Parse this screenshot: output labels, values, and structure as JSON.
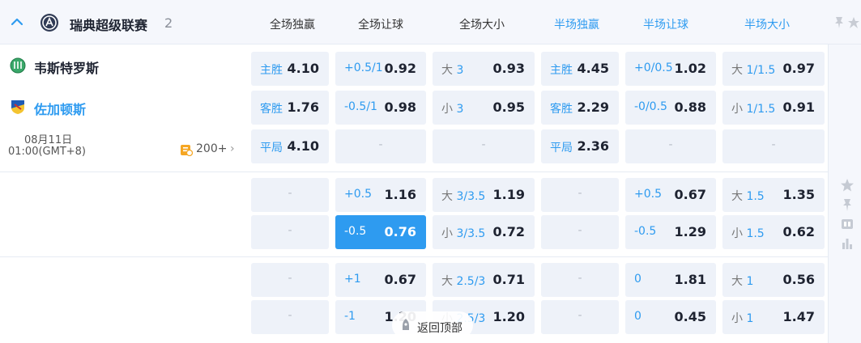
{
  "league": {
    "name": "瑞典超级联赛",
    "count": "2"
  },
  "columns": {
    "full_1x2": "全场独赢",
    "full_handicap": "全场让球",
    "full_ou": "全场大小",
    "half_1x2": "半场独赢",
    "half_handicap": "半场让球",
    "half_ou": "半场大小"
  },
  "match": {
    "home": "韦斯特罗斯",
    "away": "佐加顿斯",
    "date": "08月11日",
    "time": "01:00(GMT+8)",
    "more_count": "200+",
    "more_arrow": "›"
  },
  "odds": {
    "r1": {
      "f1x2": [
        {
          "label": "主胜",
          "val": "4.10"
        },
        {
          "label": "客胜",
          "val": "1.76"
        },
        {
          "label": "平局",
          "val": "4.10"
        }
      ],
      "fhcp": [
        {
          "label": "+0.5/1",
          "val": "0.92"
        },
        {
          "label": "-0.5/1",
          "val": "0.98"
        },
        {
          "dash": "-"
        }
      ],
      "fou": [
        {
          "pre": "大",
          "label": "3",
          "val": "0.93"
        },
        {
          "pre": "小",
          "label": "3",
          "val": "0.95"
        },
        {
          "dash": "-"
        }
      ],
      "h1x2": [
        {
          "label": "主胜",
          "val": "4.45"
        },
        {
          "label": "客胜",
          "val": "2.29"
        },
        {
          "label": "平局",
          "val": "2.36"
        }
      ],
      "hhcp": [
        {
          "label": "+0/0.5",
          "val": "1.02"
        },
        {
          "label": "-0/0.5",
          "val": "0.88"
        },
        {
          "dash": "-"
        }
      ],
      "hou": [
        {
          "pre": "大",
          "label": "1/1.5",
          "val": "0.97"
        },
        {
          "pre": "小",
          "label": "1/1.5",
          "val": "0.91"
        },
        {
          "dash": "-"
        }
      ]
    },
    "r2": {
      "f1x2": [
        {
          "dash": "-"
        },
        {
          "dash": "-"
        }
      ],
      "fhcp": [
        {
          "label": "+0.5",
          "val": "1.16"
        },
        {
          "label": "-0.5",
          "val": "0.76"
        }
      ],
      "fou": [
        {
          "pre": "大",
          "label": "3/3.5",
          "val": "1.19"
        },
        {
          "pre": "小",
          "label": "3/3.5",
          "val": "0.72"
        }
      ],
      "h1x2": [
        {
          "dash": "-"
        },
        {
          "dash": "-"
        }
      ],
      "hhcp": [
        {
          "label": "+0.5",
          "val": "0.67"
        },
        {
          "label": "-0.5",
          "val": "1.29"
        }
      ],
      "hou": [
        {
          "pre": "大",
          "label": "1.5",
          "val": "1.35"
        },
        {
          "pre": "小",
          "label": "1.5",
          "val": "0.62"
        }
      ]
    },
    "r3": {
      "f1x2": [
        {
          "dash": "-"
        },
        {
          "dash": "-"
        }
      ],
      "fhcp": [
        {
          "label": "+1",
          "val": "0.67"
        },
        {
          "label": "-1",
          "val": "1.20"
        }
      ],
      "fou": [
        {
          "pre": "大",
          "label": "2.5/3",
          "val": "0.71"
        },
        {
          "pre": "小",
          "label": "2.5/3",
          "val": "1.20"
        }
      ],
      "h1x2": [
        {
          "dash": "-"
        },
        {
          "dash": "-"
        }
      ],
      "hhcp": [
        {
          "label": "0",
          "val": "1.81"
        },
        {
          "label": "0",
          "val": "0.45"
        }
      ],
      "hou": [
        {
          "pre": "大",
          "label": "1",
          "val": "0.56"
        },
        {
          "pre": "小",
          "label": "1",
          "val": "1.47"
        }
      ]
    }
  },
  "back_to_top": "返回顶部",
  "colors": {
    "accent": "#2e9bf0",
    "cell_bg": "#eef2f9",
    "header_bg": "#f5f7fc",
    "selected_bg": "#2e9bf0"
  },
  "icons": [
    "chevron-up-icon",
    "league-logo-icon",
    "pin-icon",
    "star-icon",
    "home-team-icon",
    "away-team-icon",
    "more-markets-icon",
    "score-icon",
    "stats-icon",
    "lock-icon"
  ]
}
